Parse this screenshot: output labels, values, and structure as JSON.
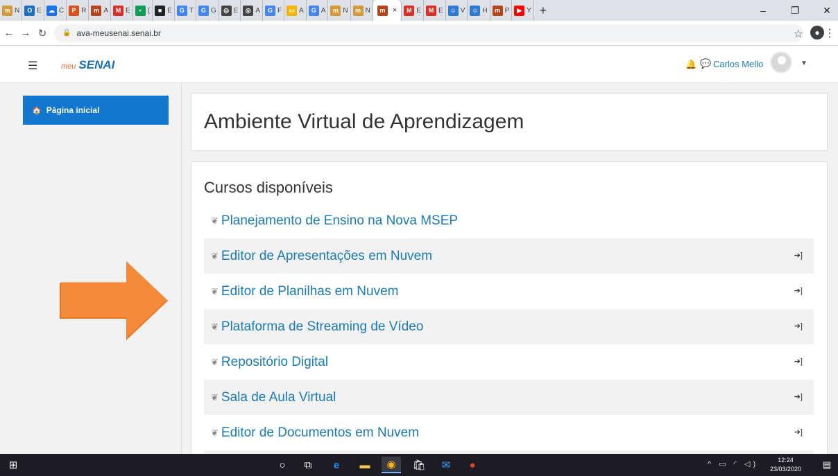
{
  "browser": {
    "tabs": [
      {
        "label": "N",
        "fav_color": "#d49a3a",
        "fav_char": "m"
      },
      {
        "label": "E",
        "fav_color": "#1e6fc4",
        "fav_char": "O"
      },
      {
        "label": "C",
        "fav_color": "#1a73e8",
        "fav_char": "☁"
      },
      {
        "label": "R",
        "fav_color": "#d9531e",
        "fav_char": "P"
      },
      {
        "label": "A",
        "fav_color": "#b5451b",
        "fav_char": "m"
      },
      {
        "label": "E",
        "fav_color": "#d93025",
        "fav_char": "M"
      },
      {
        "label": "(",
        "fav_color": "#0f9d58",
        "fav_char": "•"
      },
      {
        "label": "E",
        "fav_color": "#202124",
        "fav_char": "■"
      },
      {
        "label": "T",
        "fav_color": "#4285f4",
        "fav_char": "G"
      },
      {
        "label": "G",
        "fav_color": "#4285f4",
        "fav_char": "G"
      },
      {
        "label": "E",
        "fav_color": "#444444",
        "fav_char": "◎"
      },
      {
        "label": "A",
        "fav_color": "#444444",
        "fav_char": "◎"
      },
      {
        "label": "F",
        "fav_color": "#4285f4",
        "fav_char": "G"
      },
      {
        "label": "A",
        "fav_color": "#f4b400",
        "fav_char": "▭"
      },
      {
        "label": "A",
        "fav_color": "#4285f4",
        "fav_char": "G"
      },
      {
        "label": "N",
        "fav_color": "#d49a3a",
        "fav_char": "m"
      },
      {
        "label": "N",
        "fav_color": "#d49a3a",
        "fav_char": "m"
      }
    ],
    "active_tab": {
      "fav_char": "m",
      "close": "×"
    },
    "tabs_after": [
      {
        "label": "E",
        "fav_color": "#d93025",
        "fav_char": "M"
      },
      {
        "label": "E",
        "fav_color": "#d93025",
        "fav_char": "M"
      },
      {
        "label": "V",
        "fav_color": "#2e7bd1",
        "fav_char": "☺"
      },
      {
        "label": "H",
        "fav_color": "#2e7bd1",
        "fav_char": "☺"
      },
      {
        "label": "P",
        "fav_color": "#b5451b",
        "fav_char": "m"
      },
      {
        "label": "Y",
        "fav_color": "#ff0000",
        "fav_char": "▶"
      }
    ],
    "new_tab": "+",
    "url": "ava-meusenai.senai.br"
  },
  "navbar": {
    "logo_prefix": "meu",
    "logo": "SENAI",
    "user_name": "Carlos Mello"
  },
  "sidebar": {
    "home_label": "Página inicial"
  },
  "main": {
    "page_title": "Ambiente Virtual de Aprendizagem",
    "section_title": "Cursos disponíveis",
    "courses": [
      {
        "name": "Planejamento de Ensino na Nova MSEP",
        "enter": false
      },
      {
        "name": "Editor de Apresentações em Nuvem",
        "enter": true
      },
      {
        "name": "Editor de Planilhas em Nuvem",
        "enter": true
      },
      {
        "name": "Plataforma de Streaming de Vídeo",
        "enter": true
      },
      {
        "name": "Repositório Digital",
        "enter": true
      },
      {
        "name": "Sala de Aula Virtual",
        "enter": true
      },
      {
        "name": "Editor de Documentos em Nuvem",
        "enter": true
      },
      {
        "name": "",
        "enter": false
      }
    ]
  },
  "taskbar": {
    "time": "12:24",
    "date": "23/03/2020"
  },
  "colors": {
    "accent": "#1177d1",
    "link": "#1a7bb9",
    "arrow": "#f07f2c"
  }
}
